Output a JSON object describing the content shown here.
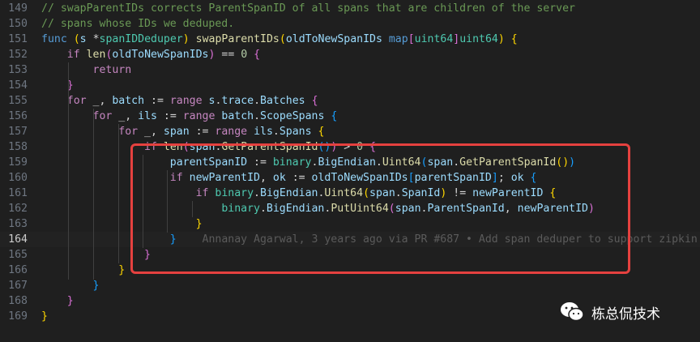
{
  "editor": {
    "lines": [
      {
        "number": "149",
        "tokens": [
          {
            "text": "// swapParentIDs corrects ParentSpanID of all spans that are children of the server",
            "cls": "c"
          }
        ]
      },
      {
        "number": "150",
        "tokens": [
          {
            "text": "// spans whose IDs we deduped.",
            "cls": "c"
          }
        ]
      },
      {
        "number": "151",
        "tokens": [
          {
            "text": "func",
            "cls": "k"
          },
          {
            "text": " ",
            "cls": "o"
          },
          {
            "text": "(",
            "cls": "b1"
          },
          {
            "text": "s",
            "cls": "v"
          },
          {
            "text": " *",
            "cls": "o"
          },
          {
            "text": "spanIDDeduper",
            "cls": "t"
          },
          {
            "text": ")",
            "cls": "b1"
          },
          {
            "text": " ",
            "cls": "o"
          },
          {
            "text": "swapParentIDs",
            "cls": "f"
          },
          {
            "text": "(",
            "cls": "b1"
          },
          {
            "text": "oldToNewSpanIDs",
            "cls": "v"
          },
          {
            "text": " ",
            "cls": "o"
          },
          {
            "text": "map",
            "cls": "k"
          },
          {
            "text": "[",
            "cls": "b2"
          },
          {
            "text": "uint64",
            "cls": "t"
          },
          {
            "text": "]",
            "cls": "b2"
          },
          {
            "text": "uint64",
            "cls": "t"
          },
          {
            "text": ")",
            "cls": "b1"
          },
          {
            "text": " ",
            "cls": "o"
          },
          {
            "text": "{",
            "cls": "b1"
          }
        ]
      },
      {
        "number": "152",
        "tokens": [
          {
            "text": "    ",
            "cls": "o"
          },
          {
            "text": "if",
            "cls": "kc"
          },
          {
            "text": " ",
            "cls": "o"
          },
          {
            "text": "len",
            "cls": "f"
          },
          {
            "text": "(",
            "cls": "b2"
          },
          {
            "text": "oldToNewSpanIDs",
            "cls": "v"
          },
          {
            "text": ")",
            "cls": "b2"
          },
          {
            "text": " == ",
            "cls": "o"
          },
          {
            "text": "0",
            "cls": "n"
          },
          {
            "text": " ",
            "cls": "o"
          },
          {
            "text": "{",
            "cls": "b2"
          }
        ]
      },
      {
        "number": "153",
        "tokens": [
          {
            "text": "        ",
            "cls": "o"
          },
          {
            "text": "return",
            "cls": "kc"
          }
        ]
      },
      {
        "number": "154",
        "tokens": [
          {
            "text": "    ",
            "cls": "o"
          },
          {
            "text": "}",
            "cls": "b2"
          }
        ]
      },
      {
        "number": "155",
        "tokens": [
          {
            "text": "    ",
            "cls": "o"
          },
          {
            "text": "for",
            "cls": "kc"
          },
          {
            "text": " _, ",
            "cls": "o"
          },
          {
            "text": "batch",
            "cls": "v"
          },
          {
            "text": " := ",
            "cls": "o"
          },
          {
            "text": "range",
            "cls": "kc"
          },
          {
            "text": " ",
            "cls": "o"
          },
          {
            "text": "s",
            "cls": "v"
          },
          {
            "text": ".",
            "cls": "o"
          },
          {
            "text": "trace",
            "cls": "v"
          },
          {
            "text": ".",
            "cls": "o"
          },
          {
            "text": "Batches",
            "cls": "v"
          },
          {
            "text": " ",
            "cls": "o"
          },
          {
            "text": "{",
            "cls": "b2"
          }
        ]
      },
      {
        "number": "156",
        "tokens": [
          {
            "text": "        ",
            "cls": "o"
          },
          {
            "text": "for",
            "cls": "kc"
          },
          {
            "text": " _, ",
            "cls": "o"
          },
          {
            "text": "ils",
            "cls": "v"
          },
          {
            "text": " := ",
            "cls": "o"
          },
          {
            "text": "range",
            "cls": "kc"
          },
          {
            "text": " ",
            "cls": "o"
          },
          {
            "text": "batch",
            "cls": "v"
          },
          {
            "text": ".",
            "cls": "o"
          },
          {
            "text": "ScopeSpans",
            "cls": "v"
          },
          {
            "text": " ",
            "cls": "o"
          },
          {
            "text": "{",
            "cls": "b3"
          }
        ]
      },
      {
        "number": "157",
        "tokens": [
          {
            "text": "            ",
            "cls": "o"
          },
          {
            "text": "for",
            "cls": "kc"
          },
          {
            "text": " _, ",
            "cls": "o"
          },
          {
            "text": "span",
            "cls": "v"
          },
          {
            "text": " := ",
            "cls": "o"
          },
          {
            "text": "range",
            "cls": "kc"
          },
          {
            "text": " ",
            "cls": "o"
          },
          {
            "text": "ils",
            "cls": "v"
          },
          {
            "text": ".",
            "cls": "o"
          },
          {
            "text": "Spans",
            "cls": "v"
          },
          {
            "text": " ",
            "cls": "o"
          },
          {
            "text": "{",
            "cls": "b1"
          }
        ]
      },
      {
        "number": "158",
        "tokens": [
          {
            "text": "                ",
            "cls": "o"
          },
          {
            "text": "if",
            "cls": "kc"
          },
          {
            "text": " ",
            "cls": "o"
          },
          {
            "text": "len",
            "cls": "f"
          },
          {
            "text": "(",
            "cls": "b2"
          },
          {
            "text": "span",
            "cls": "v"
          },
          {
            "text": ".",
            "cls": "o"
          },
          {
            "text": "GetParentSpanId",
            "cls": "f"
          },
          {
            "text": "()",
            "cls": "b3"
          },
          {
            "text": ")",
            "cls": "b2"
          },
          {
            "text": " > ",
            "cls": "o"
          },
          {
            "text": "0",
            "cls": "n"
          },
          {
            "text": " ",
            "cls": "o"
          },
          {
            "text": "{",
            "cls": "b2"
          }
        ]
      },
      {
        "number": "159",
        "tokens": [
          {
            "text": "                    ",
            "cls": "o"
          },
          {
            "text": "parentSpanID",
            "cls": "v"
          },
          {
            "text": " := ",
            "cls": "o"
          },
          {
            "text": "binary",
            "cls": "t"
          },
          {
            "text": ".",
            "cls": "o"
          },
          {
            "text": "BigEndian",
            "cls": "v"
          },
          {
            "text": ".",
            "cls": "o"
          },
          {
            "text": "Uint64",
            "cls": "f"
          },
          {
            "text": "(",
            "cls": "b3"
          },
          {
            "text": "span",
            "cls": "v"
          },
          {
            "text": ".",
            "cls": "o"
          },
          {
            "text": "GetParentSpanId",
            "cls": "f"
          },
          {
            "text": "()",
            "cls": "b1"
          },
          {
            "text": ")",
            "cls": "b3"
          }
        ]
      },
      {
        "number": "160",
        "tokens": [
          {
            "text": "                    ",
            "cls": "o"
          },
          {
            "text": "if",
            "cls": "kc"
          },
          {
            "text": " ",
            "cls": "o"
          },
          {
            "text": "newParentID",
            "cls": "v"
          },
          {
            "text": ", ",
            "cls": "o"
          },
          {
            "text": "ok",
            "cls": "v"
          },
          {
            "text": " := ",
            "cls": "o"
          },
          {
            "text": "oldToNewSpanIDs",
            "cls": "v"
          },
          {
            "text": "[",
            "cls": "b3"
          },
          {
            "text": "parentSpanID",
            "cls": "v"
          },
          {
            "text": "]",
            "cls": "b3"
          },
          {
            "text": "; ",
            "cls": "o"
          },
          {
            "text": "ok",
            "cls": "v"
          },
          {
            "text": " ",
            "cls": "o"
          },
          {
            "text": "{",
            "cls": "b3"
          }
        ]
      },
      {
        "number": "161",
        "tokens": [
          {
            "text": "                        ",
            "cls": "o"
          },
          {
            "text": "if",
            "cls": "kc"
          },
          {
            "text": " ",
            "cls": "o"
          },
          {
            "text": "binary",
            "cls": "t"
          },
          {
            "text": ".",
            "cls": "o"
          },
          {
            "text": "BigEndian",
            "cls": "v"
          },
          {
            "text": ".",
            "cls": "o"
          },
          {
            "text": "Uint64",
            "cls": "f"
          },
          {
            "text": "(",
            "cls": "b1"
          },
          {
            "text": "span",
            "cls": "v"
          },
          {
            "text": ".",
            "cls": "o"
          },
          {
            "text": "SpanId",
            "cls": "v"
          },
          {
            "text": ")",
            "cls": "b1"
          },
          {
            "text": " != ",
            "cls": "o"
          },
          {
            "text": "newParentID",
            "cls": "v"
          },
          {
            "text": " ",
            "cls": "o"
          },
          {
            "text": "{",
            "cls": "b1"
          }
        ]
      },
      {
        "number": "162",
        "tokens": [
          {
            "text": "                            ",
            "cls": "o"
          },
          {
            "text": "binary",
            "cls": "t"
          },
          {
            "text": ".",
            "cls": "o"
          },
          {
            "text": "BigEndian",
            "cls": "v"
          },
          {
            "text": ".",
            "cls": "o"
          },
          {
            "text": "PutUint64",
            "cls": "f"
          },
          {
            "text": "(",
            "cls": "b2"
          },
          {
            "text": "span",
            "cls": "v"
          },
          {
            "text": ".",
            "cls": "o"
          },
          {
            "text": "ParentSpanId",
            "cls": "v"
          },
          {
            "text": ", ",
            "cls": "o"
          },
          {
            "text": "newParentID",
            "cls": "v"
          },
          {
            "text": ")",
            "cls": "b2"
          }
        ]
      },
      {
        "number": "163",
        "tokens": [
          {
            "text": "                        ",
            "cls": "o"
          },
          {
            "text": "}",
            "cls": "b1"
          }
        ]
      },
      {
        "number": "164",
        "current": true,
        "tokens": [
          {
            "text": "                    ",
            "cls": "o"
          },
          {
            "text": "}",
            "cls": "b3"
          },
          {
            "text": "    Annanay Agarwal, 3 years ago via PR #687 • Add span deduper to support zipkin",
            "cls": "blame"
          }
        ]
      },
      {
        "number": "165",
        "tokens": [
          {
            "text": "                ",
            "cls": "o"
          },
          {
            "text": "}",
            "cls": "b2"
          }
        ]
      },
      {
        "number": "166",
        "tokens": [
          {
            "text": "            ",
            "cls": "o"
          },
          {
            "text": "}",
            "cls": "b1"
          }
        ]
      },
      {
        "number": "167",
        "tokens": [
          {
            "text": "        ",
            "cls": "o"
          },
          {
            "text": "}",
            "cls": "b3"
          }
        ]
      },
      {
        "number": "168",
        "tokens": [
          {
            "text": "    ",
            "cls": "o"
          },
          {
            "text": "}",
            "cls": "b2"
          }
        ]
      },
      {
        "number": "169",
        "tokens": [
          {
            "text": "}",
            "cls": "b1"
          }
        ]
      }
    ]
  },
  "watermark": {
    "icon": "wechat-icon",
    "text": "栋总侃技术"
  },
  "colors": {
    "highlight_border": "#e5413f",
    "background": "#1f1f1f"
  }
}
